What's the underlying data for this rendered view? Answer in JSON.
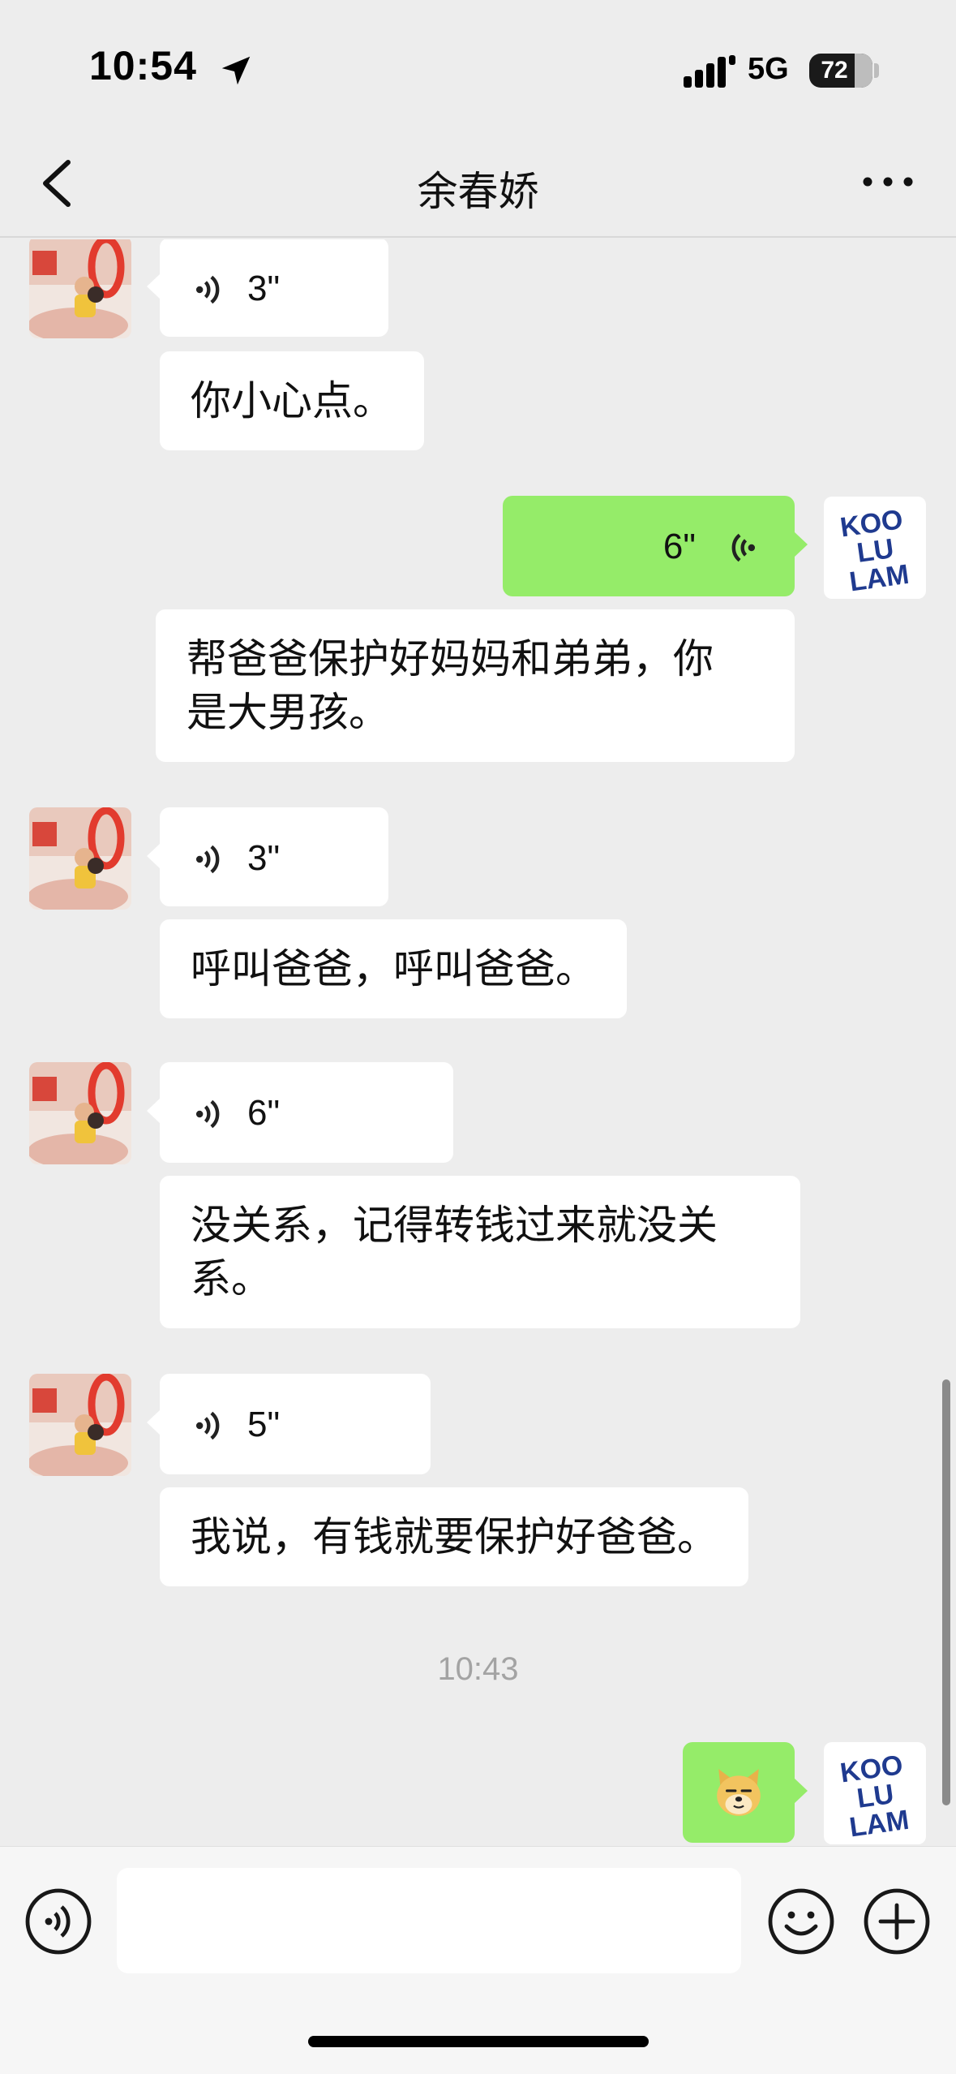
{
  "status_bar": {
    "time": "10:54",
    "network": "5G",
    "battery_percent": 72,
    "battery_label": "72"
  },
  "header": {
    "title": "余春娇",
    "back_icon": "chevron-left-icon",
    "more_icon": "ellipsis-icon"
  },
  "messages": [
    {
      "from": "contact",
      "type": "voice",
      "duration": "3\""
    },
    {
      "from": "contact",
      "type": "text",
      "text": "你小心点。"
    },
    {
      "from": "me",
      "type": "voice",
      "duration": "6\""
    },
    {
      "from": "me",
      "type": "text",
      "lines": [
        "帮爸爸保护好妈妈和弟弟，你",
        "是大男孩。"
      ]
    },
    {
      "from": "contact",
      "type": "voice",
      "duration": "3\""
    },
    {
      "from": "contact",
      "type": "text",
      "text": "呼叫爸爸，呼叫爸爸。"
    },
    {
      "from": "contact",
      "type": "voice",
      "duration": "6\""
    },
    {
      "from": "contact",
      "type": "text",
      "lines": [
        "没关系，记得转钱过来就没关",
        "系。"
      ]
    },
    {
      "from": "contact",
      "type": "voice",
      "duration": "5\""
    },
    {
      "from": "contact",
      "type": "text",
      "text": "我说，有钱就要保护好爸爸。"
    },
    {
      "type": "timestamp",
      "text": "10:43"
    },
    {
      "from": "me",
      "type": "sticker",
      "sticker": "doge-emoji"
    }
  ],
  "my_avatar": {
    "text": "KOOLULAM",
    "lines": [
      "KOO",
      "LU",
      "LAM"
    ]
  },
  "input_bar": {
    "placeholder": "",
    "voice_icon": "voice-toggle-icon",
    "emoji_icon": "smiley-icon",
    "plus_icon": "plus-circle-icon"
  },
  "colors": {
    "background": "#ededed",
    "incoming_bubble": "#ffffff",
    "outgoing_bubble": "#95ec69",
    "timestamp": "#a3a3a3"
  }
}
